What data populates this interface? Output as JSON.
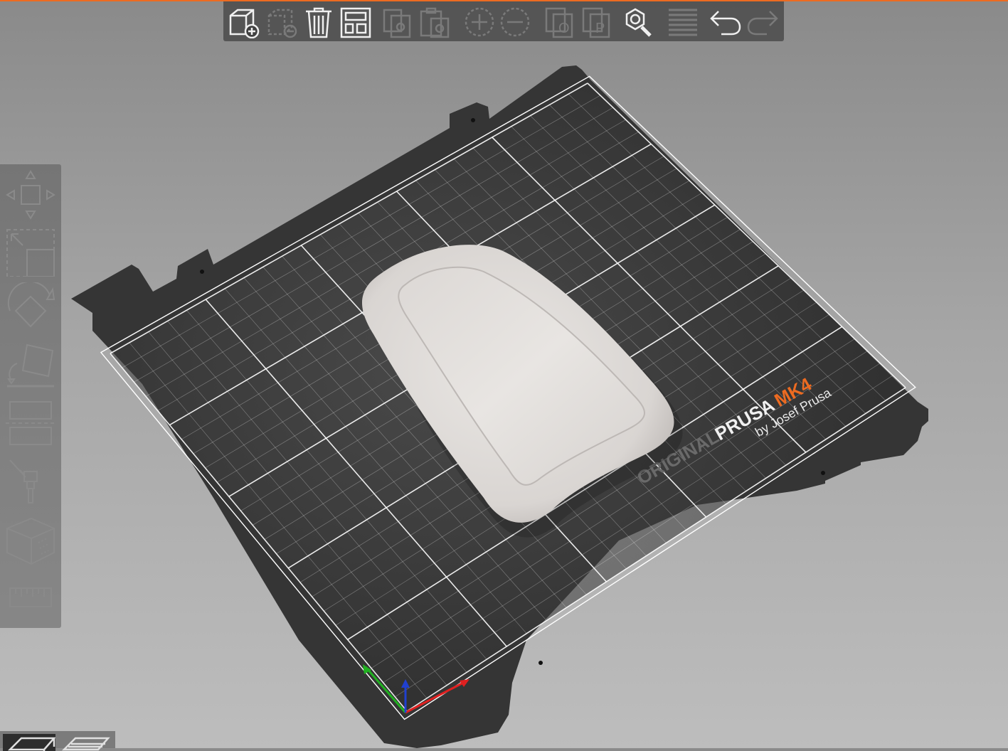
{
  "window": {
    "accent_color": "#ed6b21"
  },
  "bed": {
    "brand_original": "ORIGINAL",
    "brand_prusa": "PRUSA",
    "brand_model": "MK4",
    "brand_tagline": "by Josef Prusa",
    "plate_color": "#353535",
    "grid_color": "#ffffff",
    "brand_accent": "#ed6b21"
  },
  "model": {
    "color": "#e3dfdc"
  },
  "axes": {
    "x_color": "#e02020",
    "y_color": "#20b020",
    "z_color": "#2040d0"
  },
  "top_toolbar": {
    "items": [
      {
        "name": "add-object",
        "icon": "cube-plus-icon",
        "enabled": true
      },
      {
        "name": "delete",
        "icon": "cube-minus-icon",
        "enabled": false
      },
      {
        "name": "delete-all",
        "icon": "trash-icon",
        "enabled": true
      },
      {
        "name": "arrange",
        "icon": "arrange-icon",
        "enabled": true
      },
      {
        "name": "copy",
        "icon": "copy-icon",
        "enabled": false
      },
      {
        "name": "paste",
        "icon": "paste-icon",
        "enabled": false
      },
      {
        "name": "add-instance",
        "icon": "plus-circle-icon",
        "enabled": false
      },
      {
        "name": "remove-instance",
        "icon": "minus-circle-icon",
        "enabled": false
      },
      {
        "name": "split-objects",
        "icon": "split-objects-icon",
        "enabled": false
      },
      {
        "name": "split-parts",
        "icon": "split-parts-icon",
        "enabled": false
      },
      {
        "name": "search",
        "icon": "search-icon",
        "enabled": true
      },
      {
        "name": "layers-editing",
        "icon": "layers-icon",
        "enabled": false
      },
      {
        "name": "undo",
        "icon": "undo-icon",
        "enabled": true
      },
      {
        "name": "redo",
        "icon": "redo-icon",
        "enabled": false
      }
    ]
  },
  "left_toolbar": {
    "items": [
      {
        "name": "move",
        "icon": "move-icon"
      },
      {
        "name": "scale",
        "icon": "scale-icon"
      },
      {
        "name": "rotate",
        "icon": "rotate-icon"
      },
      {
        "name": "place-on-face",
        "icon": "place-on-face-icon"
      },
      {
        "name": "cut",
        "icon": "cut-icon"
      },
      {
        "name": "paint-supports",
        "icon": "paint-brush-icon"
      },
      {
        "name": "seam-painting",
        "icon": "cube-seam-icon"
      },
      {
        "name": "measure",
        "icon": "ruler-icon"
      }
    ]
  },
  "view_tabs": [
    {
      "name": "3d-view",
      "active": true
    },
    {
      "name": "preview",
      "active": false
    }
  ]
}
